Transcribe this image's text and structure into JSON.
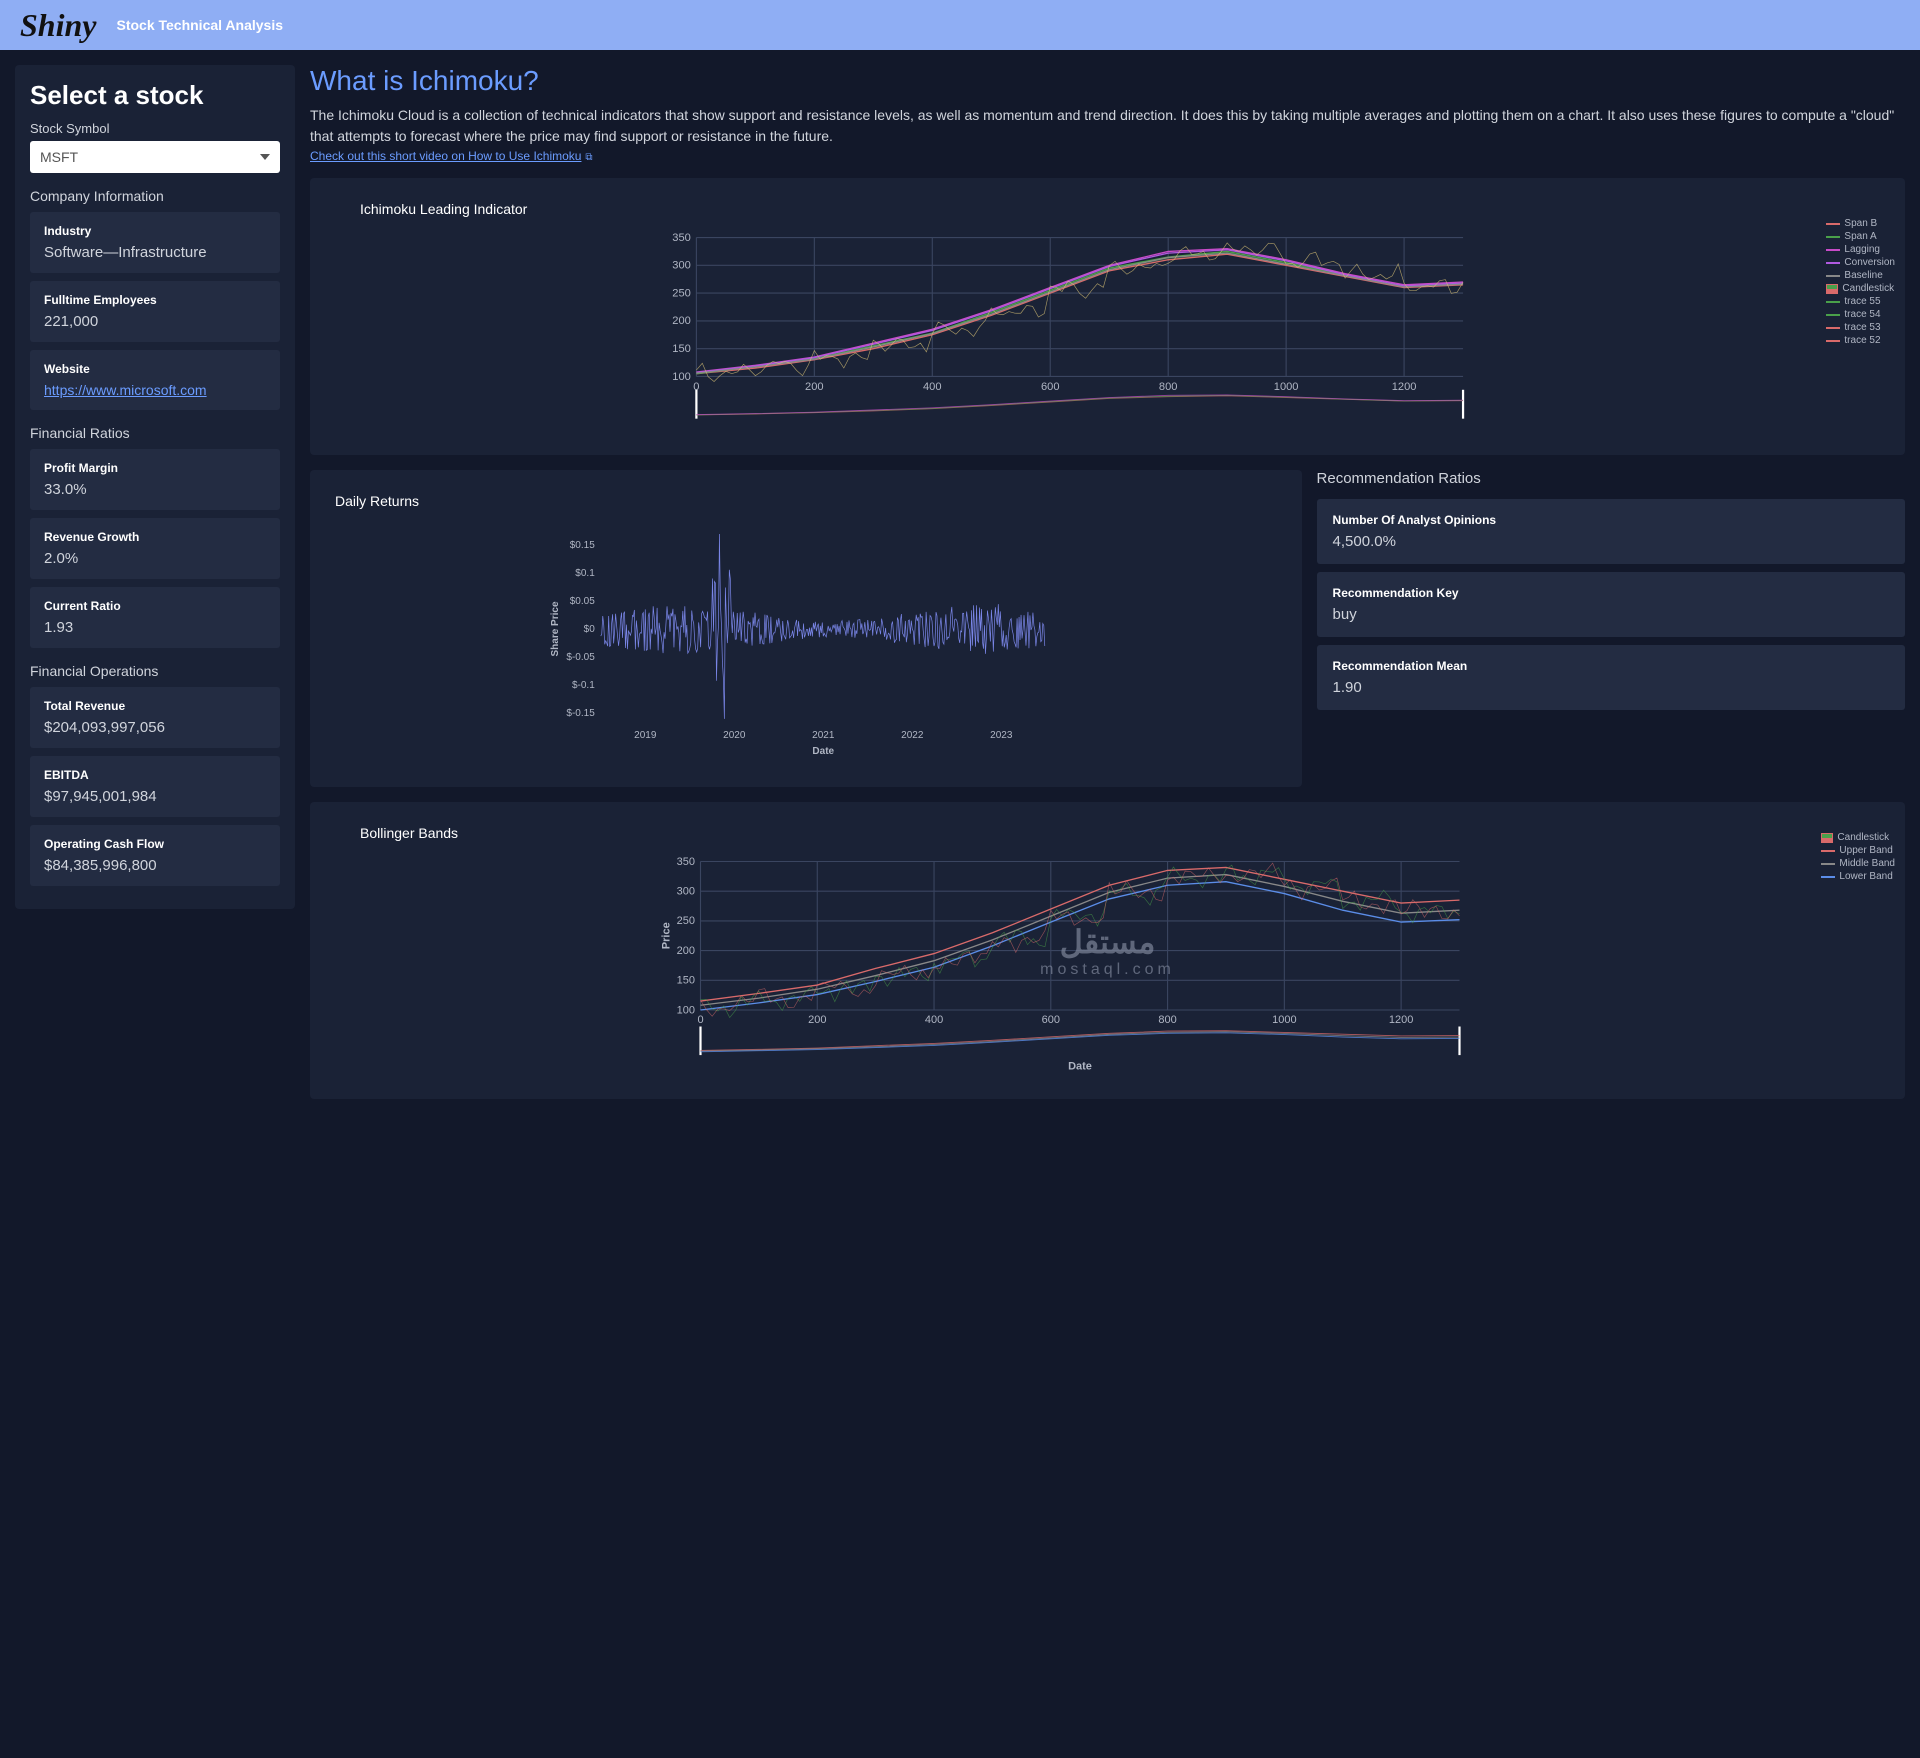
{
  "header": {
    "logo": "Shiny",
    "title": "Stock Technical Analysis"
  },
  "sidebar": {
    "heading": "Select a stock",
    "symbol_label": "Stock Symbol",
    "symbol_value": "MSFT",
    "company_info_title": "Company Information",
    "company_info": [
      {
        "label": "Industry",
        "value": "Software—Infrastructure"
      },
      {
        "label": "Fulltime Employees",
        "value": "221,000"
      },
      {
        "label": "Website",
        "value": "https://www.microsoft.com",
        "is_link": true
      }
    ],
    "ratios_title": "Financial Ratios",
    "ratios": [
      {
        "label": "Profit Margin",
        "value": "33.0%"
      },
      {
        "label": "Revenue Growth",
        "value": "2.0%"
      },
      {
        "label": "Current Ratio",
        "value": "1.93"
      }
    ],
    "ops_title": "Financial Operations",
    "ops": [
      {
        "label": "Total Revenue",
        "value": "$204,093,997,056"
      },
      {
        "label": "EBITDA",
        "value": "$97,945,001,984"
      },
      {
        "label": "Operating Cash Flow",
        "value": "$84,385,996,800"
      }
    ]
  },
  "main": {
    "heading": "What is Ichimoku?",
    "description": "The Ichimoku Cloud is a collection of technical indicators that show support and resistance levels, as well as momentum and trend direction. It does this by taking multiple averages and plotting them on a chart. It also uses these figures to compute a \"cloud\" that attempts to forecast where the price may find support or resistance in the future.",
    "video_link": "Check out this short video on How to Use Ichimoku"
  },
  "ichimoku": {
    "title": "Ichimoku Leading Indicator",
    "legend": [
      "Span B",
      "Span A",
      "Lagging",
      "Conversion",
      "Baseline",
      "Candlestick",
      "trace 55",
      "trace 54",
      "trace 53",
      "trace 52"
    ]
  },
  "daily_returns": {
    "title": "Daily Returns",
    "ylabel": "Share Price",
    "xlabel": "Date"
  },
  "rec": {
    "title": "Recommendation Ratios",
    "items": [
      {
        "label": "Number Of Analyst Opinions",
        "value": "4,500.0%"
      },
      {
        "label": "Recommendation Key",
        "value": "buy"
      },
      {
        "label": "Recommendation Mean",
        "value": "1.90"
      }
    ]
  },
  "bollinger": {
    "title": "Bollinger Bands",
    "xlabel": "Date",
    "ylabel": "Price",
    "legend": [
      "Candlestick",
      "Upper Band",
      "Middle Band",
      "Lower Band"
    ]
  },
  "chart_data": [
    {
      "type": "line",
      "title": "Ichimoku Leading Indicator",
      "x_range": [
        0,
        1300
      ],
      "x_ticks": [
        0,
        200,
        400,
        600,
        800,
        1000,
        1200
      ],
      "y_range": [
        100,
        350
      ],
      "y_ticks": [
        100,
        150,
        200,
        250,
        300,
        350
      ],
      "series": [
        {
          "name": "Span B",
          "color": "#d96a6a",
          "values_approx": [
            105,
            115,
            130,
            150,
            175,
            210,
            250,
            290,
            310,
            320,
            300,
            280,
            260,
            265
          ]
        },
        {
          "name": "Span A",
          "color": "#4aa04a",
          "values_approx": [
            105,
            118,
            132,
            155,
            178,
            215,
            255,
            295,
            315,
            325,
            305,
            282,
            262,
            268
          ]
        },
        {
          "name": "Lagging",
          "color": "#c84bc8",
          "values_approx": [
            108,
            120,
            135,
            160,
            185,
            220,
            260,
            300,
            325,
            330,
            310,
            285,
            265,
            270
          ]
        },
        {
          "name": "Conversion",
          "color": "#b05ae0",
          "values_approx": [
            107,
            119,
            134,
            158,
            183,
            218,
            258,
            298,
            322,
            328,
            308,
            283,
            263,
            268
          ]
        },
        {
          "name": "Baseline",
          "color": "#888",
          "values_approx": [
            106,
            117,
            131,
            153,
            177,
            212,
            252,
            292,
            314,
            322,
            302,
            281,
            261,
            266
          ]
        }
      ],
      "x_samples": [
        0,
        100,
        200,
        300,
        400,
        500,
        600,
        700,
        800,
        900,
        1000,
        1100,
        1200,
        1300
      ]
    },
    {
      "type": "line",
      "title": "Daily Returns",
      "xlabel": "Date",
      "ylabel": "Share Price",
      "x_ticks": [
        "2019",
        "2020",
        "2021",
        "2022",
        "2023"
      ],
      "y_ticks": [
        -0.15,
        -0.1,
        -0.05,
        0,
        0.05,
        0.1,
        0.15
      ],
      "y_range": [
        -0.17,
        0.17
      ],
      "note": "high-frequency noisy series centered near 0; spike to ~+0.15 and trough ~-0.15 around early 2020"
    },
    {
      "type": "line",
      "title": "Bollinger Bands",
      "xlabel": "Date",
      "ylabel": "Price",
      "x_range": [
        0,
        1300
      ],
      "x_ticks": [
        0,
        200,
        400,
        600,
        800,
        1000,
        1200
      ],
      "y_range": [
        100,
        350
      ],
      "y_ticks": [
        100,
        150,
        200,
        250,
        300,
        350
      ],
      "series": [
        {
          "name": "Upper Band",
          "color": "#d96a6a",
          "values_approx": [
            115,
            128,
            142,
            170,
            195,
            230,
            270,
            310,
            335,
            340,
            320,
            300,
            280,
            285
          ]
        },
        {
          "name": "Middle Band",
          "color": "#888",
          "values_approx": [
            108,
            120,
            135,
            158,
            183,
            218,
            258,
            298,
            322,
            328,
            308,
            283,
            263,
            268
          ]
        },
        {
          "name": "Lower Band",
          "color": "#5b8de8",
          "values_approx": [
            100,
            112,
            126,
            148,
            172,
            208,
            248,
            287,
            310,
            316,
            296,
            268,
            248,
            252
          ]
        }
      ],
      "x_samples": [
        0,
        100,
        200,
        300,
        400,
        500,
        600,
        700,
        800,
        900,
        1000,
        1100,
        1200,
        1300
      ]
    }
  ]
}
